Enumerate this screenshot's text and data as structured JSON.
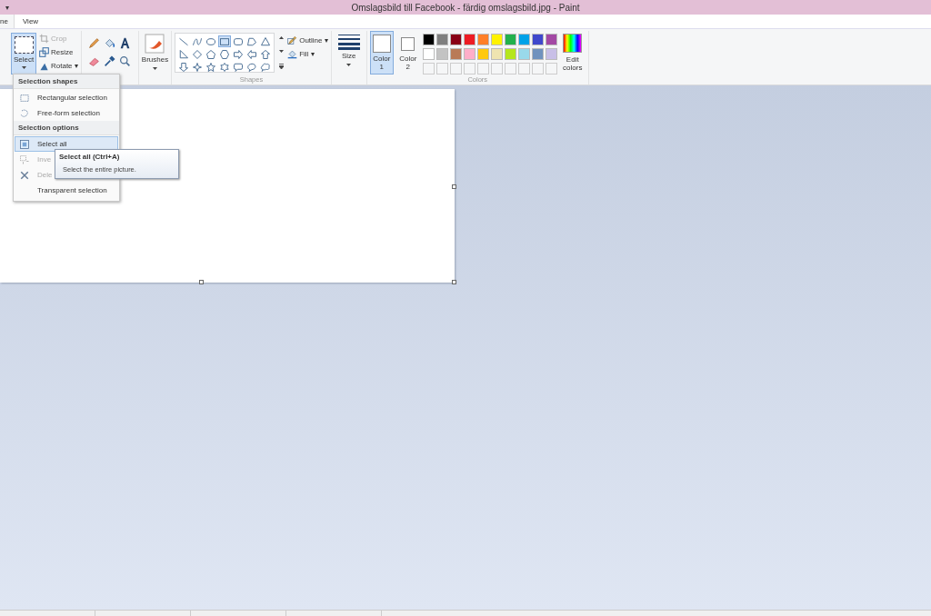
{
  "window": {
    "title": "Omslagsbild till Facebook - färdig omslagsbild.jpg - Paint",
    "quick_access": "▾"
  },
  "tabs": [
    {
      "label": "ne",
      "selected": true
    },
    {
      "label": "View",
      "selected": false
    }
  ],
  "ribbon": {
    "image": {
      "select": {
        "label": "Select",
        "pressed": true
      },
      "crop": {
        "label": "Crop",
        "disabled": true
      },
      "resize": {
        "label": "Resize",
        "disabled": false
      },
      "rotate": {
        "label": "Rotate ▾",
        "disabled": false
      }
    },
    "brushes": {
      "label": "Brushes"
    },
    "shapes": {
      "label": "Shapes",
      "items": [
        {
          "kind": "line",
          "selected": false
        },
        {
          "kind": "curve",
          "selected": false
        },
        {
          "kind": "oval",
          "selected": false
        },
        {
          "kind": "rectangle",
          "selected": true
        },
        {
          "kind": "rounded-rectangle",
          "selected": false
        },
        {
          "kind": "polygon",
          "selected": false
        },
        {
          "kind": "triangle",
          "selected": false
        },
        {
          "kind": "right-triangle",
          "selected": false
        },
        {
          "kind": "diamond",
          "selected": false
        },
        {
          "kind": "pentagon",
          "selected": false
        },
        {
          "kind": "hexagon",
          "selected": false
        },
        {
          "kind": "right-arrow",
          "selected": false
        },
        {
          "kind": "left-arrow",
          "selected": false
        },
        {
          "kind": "up-arrow",
          "selected": false
        },
        {
          "kind": "down-arrow",
          "selected": false
        },
        {
          "kind": "four-point-star",
          "selected": false
        },
        {
          "kind": "five-point-star",
          "selected": false
        },
        {
          "kind": "six-point-star",
          "selected": false
        },
        {
          "kind": "rounded-callout",
          "selected": false
        },
        {
          "kind": "oval-callout",
          "selected": false
        },
        {
          "kind": "cloud-callout",
          "selected": false
        }
      ],
      "outline": "Outline ▾",
      "fill": "Fill ▾"
    },
    "size": {
      "label": "Size"
    },
    "colors": {
      "label": "Colors",
      "color1": {
        "label": "Color 1",
        "selected": true
      },
      "color2": {
        "label": "Color 2",
        "selected": false
      },
      "edit": "Edit colors",
      "palette": [
        {
          "color": "#000000"
        },
        {
          "color": "#7f7f7f"
        },
        {
          "color": "#880015"
        },
        {
          "color": "#ed1c24"
        },
        {
          "color": "#ff7f27"
        },
        {
          "color": "#fff200"
        },
        {
          "color": "#22b14c"
        },
        {
          "color": "#00a2e8"
        },
        {
          "color": "#3f48cc"
        },
        {
          "color": "#a349a4"
        },
        {
          "color": "#ffffff"
        },
        {
          "color": "#c3c3c3"
        },
        {
          "color": "#b97a57"
        },
        {
          "color": "#ffaec9"
        },
        {
          "color": "#ffc90e"
        },
        {
          "color": "#efe4b0"
        },
        {
          "color": "#b5e61d"
        },
        {
          "color": "#99d9ea"
        },
        {
          "color": "#7092be"
        },
        {
          "color": "#c8bfe7"
        }
      ]
    }
  },
  "select_menu": [
    {
      "kind": "header",
      "label": "Selection shapes"
    },
    {
      "kind": "rectangular",
      "label": "Rectangular selection",
      "selected": false,
      "disabled": false
    },
    {
      "kind": "freeform",
      "label": "Free-form selection",
      "selected": false,
      "disabled": false
    },
    {
      "kind": "header",
      "label": "Selection options"
    },
    {
      "kind": "selectall",
      "label": "Select all",
      "selected": true,
      "disabled": false
    },
    {
      "kind": "invert",
      "label": "Inve",
      "selected": false,
      "disabled": true
    },
    {
      "kind": "delete",
      "label": "Dele",
      "selected": false,
      "disabled": true
    },
    {
      "kind": "plain",
      "label": "Transparent selection",
      "selected": false,
      "disabled": false
    }
  ],
  "tooltip": {
    "title": "Select all (Ctrl+A)",
    "description": "Select the entire picture."
  }
}
